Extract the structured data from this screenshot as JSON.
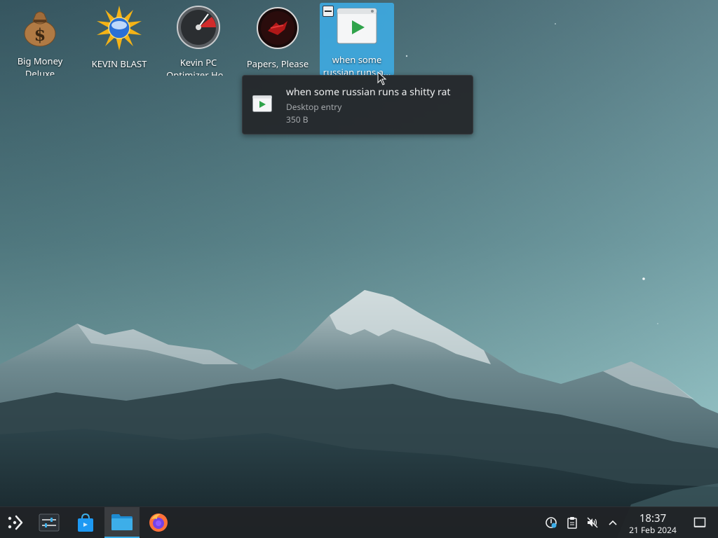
{
  "desktop": {
    "icons": [
      {
        "label": "Big Money Deluxe",
        "icon": "money-bag-icon"
      },
      {
        "label": "KEVIN BLAST",
        "icon": "starburst-globe-icon"
      },
      {
        "label": "Kevin PC Optimizer Ho...",
        "icon": "speedometer-icon"
      },
      {
        "label": "Papers, Please",
        "icon": "papers-please-icon"
      },
      {
        "label": "when some russian runs a...",
        "icon": "desktop-entry-icon",
        "selected": true
      }
    ]
  },
  "tooltip": {
    "title": "when some russian runs a shitty rat",
    "type": "Desktop entry",
    "size": "350 B"
  },
  "taskbar": {
    "apps": [
      "application-launcher",
      "system-settings",
      "discover",
      "dolphin-file-manager",
      "firefox"
    ],
    "active_app": "dolphin-file-manager",
    "tray": [
      "network-icon",
      "clipboard-icon",
      "volume-muted-icon",
      "show-hidden-icons-arrow"
    ],
    "time": "18:37",
    "date": "21 Feb 2024"
  },
  "colors": {
    "selection": "#3daee9",
    "panel": "#202326",
    "tooltip_bg": "#232629"
  }
}
